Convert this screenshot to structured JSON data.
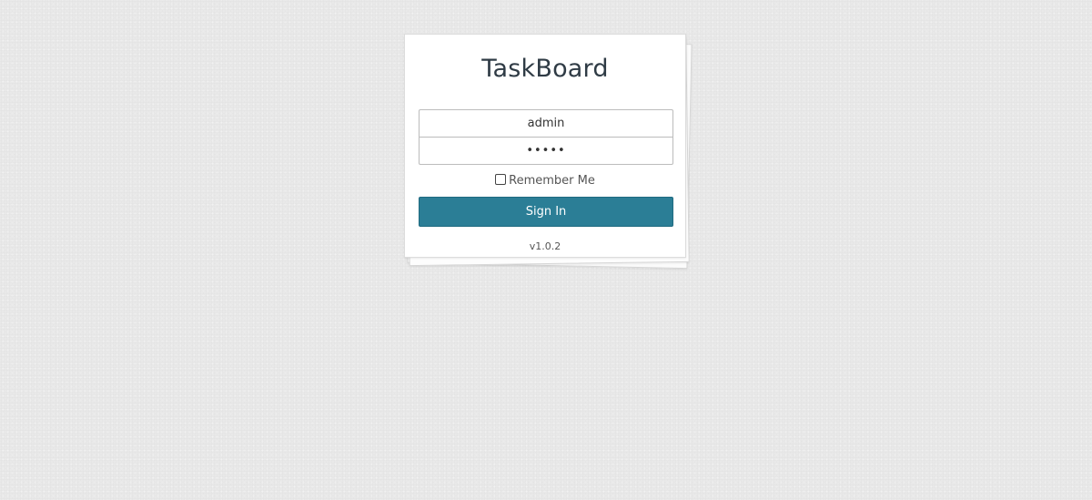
{
  "app": {
    "title": "TaskBoard",
    "version": "v1.0.2"
  },
  "login": {
    "username_value": "admin",
    "password_value": "•••••",
    "remember_label": "Remember Me",
    "remember_checked": false,
    "submit_label": "Sign In"
  },
  "colors": {
    "background": "#e9e9e9",
    "card": "#ffffff",
    "button": "#2b7e96",
    "title_text": "#2f3b45"
  }
}
